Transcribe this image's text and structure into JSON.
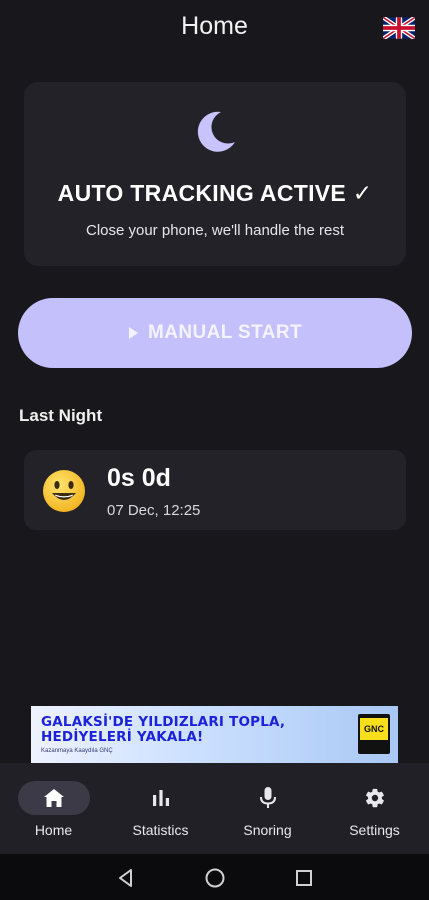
{
  "header": {
    "title": "Home",
    "flag_icon": "uk-flag-icon"
  },
  "auto_card": {
    "icon": "moon-icon",
    "title": "AUTO TRACKING ACTIVE ✓",
    "subtitle": "Close your phone, we'll handle the rest"
  },
  "manual_button": {
    "icon": "play-icon",
    "label": "MANUAL START"
  },
  "last_night": {
    "section_label": "Last Night",
    "icon": "smiley-face-icon",
    "duration": "0s 0d",
    "date": "07 Dec, 12:25"
  },
  "ad": {
    "line1": "GALAKSİ'DE YILDIZLARI TOPLA,",
    "line2": "HEDİYELERİ YAKALA!",
    "small_text": "Kazanmaya Kaaydıla GNÇ",
    "logo_text": "GNC"
  },
  "bottom_nav": {
    "items": [
      {
        "label": "Home",
        "icon": "home-icon",
        "active": true
      },
      {
        "label": "Statistics",
        "icon": "bar-chart-icon",
        "active": false
      },
      {
        "label": "Snoring",
        "icon": "microphone-icon",
        "active": false
      },
      {
        "label": "Settings",
        "icon": "gear-icon",
        "active": false
      }
    ]
  },
  "system_nav": {
    "back_icon": "back-triangle-icon",
    "home_icon": "home-circle-icon",
    "recents_icon": "recents-square-icon"
  },
  "colors": {
    "background": "#18171c",
    "card": "#232228",
    "accent": "#c4c0fb",
    "nav_bar": "#212026"
  }
}
